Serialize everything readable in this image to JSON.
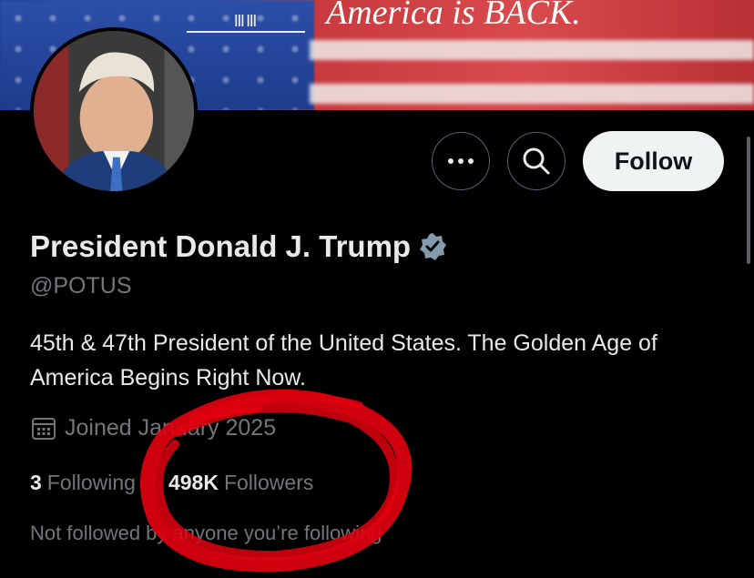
{
  "banner": {
    "slogan": "America is BACK.",
    "logo_text": "ⅢⅢ"
  },
  "profile": {
    "display_name": "President Donald J. Trump",
    "handle": "@POTUS",
    "bio": "45th & 47th President of the United States. The Golden Age of America Begins Right Now.",
    "joined": "Joined January 2025",
    "following_count": "3",
    "following_label": "Following",
    "followers_count": "498K",
    "followers_label": "Followers",
    "mutuals_text": "Not followed by anyone you’re following"
  },
  "actions": {
    "more_label": "•••",
    "follow_label": "Follow"
  },
  "icons": {
    "more": "more-icon",
    "search": "search-icon",
    "verified": "verified-badge-icon",
    "calendar": "calendar-icon"
  },
  "colors": {
    "background": "#000000",
    "verified_badge": "#829aab",
    "annotation": "#e0000f",
    "follow_button_bg": "#eff3f4"
  }
}
